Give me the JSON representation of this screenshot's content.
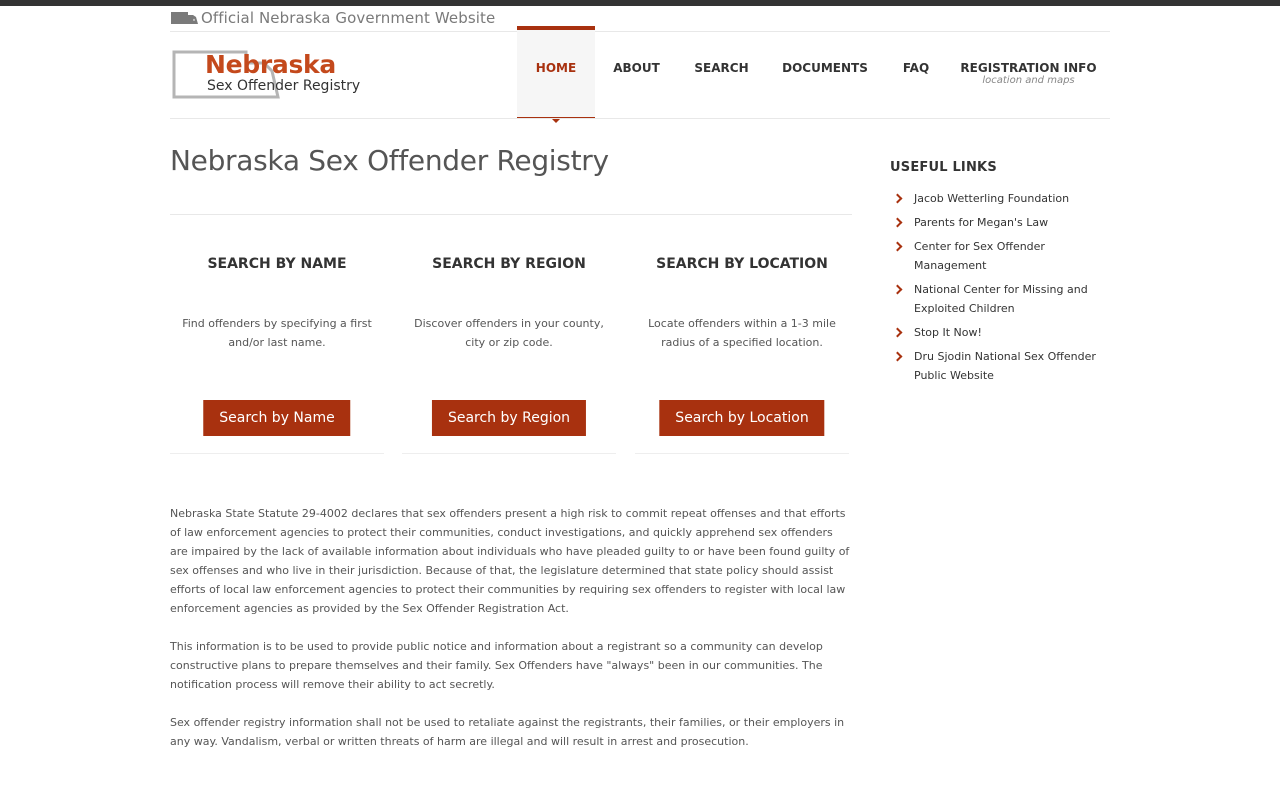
{
  "banner": {
    "text": "Official Nebraska Government Website"
  },
  "logo": {
    "state": "Nebraska",
    "subtitle": "Sex Offender Registry"
  },
  "nav": {
    "home": "HOME",
    "about": "ABOUT",
    "search": "SEARCH",
    "documents": "DOCUMENTS",
    "faq": "FAQ",
    "registration": "REGISTRATION INFO",
    "registration_sub": "location and maps"
  },
  "page_title": "Nebraska Sex Offender Registry",
  "search_boxes": [
    {
      "title": "SEARCH BY NAME",
      "description": "Find offenders by specifying a first and/or last name.",
      "button": "Search by Name"
    },
    {
      "title": "SEARCH BY REGION",
      "description": "Discover offenders in your county, city or zip code.",
      "button": "Search by Region"
    },
    {
      "title": "SEARCH BY LOCATION",
      "description": "Locate offenders within a 1-3 mile radius of a specified location.",
      "button": "Search by Location"
    }
  ],
  "body": [
    "Nebraska State Statute 29-4002 declares that sex offenders present a high risk to commit repeat offenses and that efforts of law enforcement agencies to protect their communities, conduct investigations, and quickly apprehend sex offenders are impaired by the lack of available information about individuals who have pleaded guilty to or have been found guilty of sex offenses and who live in their jurisdiction. Because of that, the legislature determined that state policy should assist efforts of local law enforcement agencies to protect their communities by requiring sex offenders to register with local law enforcement agencies as provided by the Sex Offender Registration Act.",
    "This information is to be used to provide public notice and information about a registrant so a community can develop constructive plans to prepare themselves and their family. Sex Offenders have \"always\" been in our communities. The notification process will remove their ability to act secretly.",
    "Sex offender registry information shall not be used to retaliate against the registrants, their families, or their employers in any way. Vandalism, verbal or written threats of harm are illegal and will result in arrest and prosecution."
  ],
  "sidebar": {
    "title": "USEFUL LINKS",
    "links": [
      "Jacob Wetterling Foundation",
      "Parents for Megan's Law",
      "Center for Sex Offender Management",
      "National Center for Missing and Exploited Children",
      "Stop It Now!",
      "Dru Sjodin National Sex Offender Public Website"
    ]
  },
  "colors": {
    "accent": "#a8310f",
    "logo_orange": "#c4491c",
    "text": "#555555",
    "heading": "#333333"
  }
}
